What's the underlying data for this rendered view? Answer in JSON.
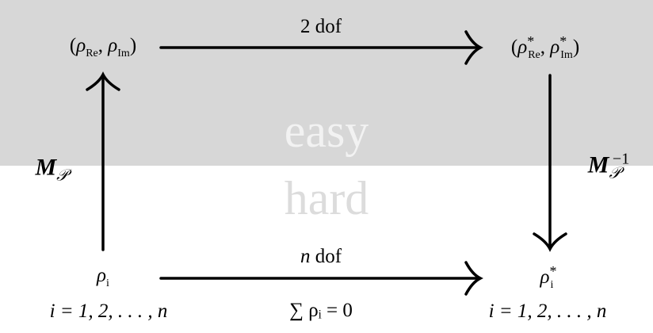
{
  "watermark": {
    "upper": "easy",
    "lower": "hard"
  },
  "nodes": {
    "top_left": {
      "rho": "ρ",
      "re": "Re",
      "im": "Im"
    },
    "top_right": {
      "rho": "ρ",
      "star": "*",
      "re": "Re",
      "im": "Im"
    },
    "bottom_left": {
      "rho": "ρ",
      "i": "i",
      "range": "i = 1, 2, . . . , n"
    },
    "bottom_right": {
      "rho": "ρ",
      "i": "i",
      "star": "*",
      "range": "i = 1, 2, . . . , n"
    }
  },
  "edges": {
    "top": {
      "label": "2 dof"
    },
    "bottom": {
      "label_var": "n",
      "label_rest": " dof",
      "constraint": "∑ ρᵢ = 0"
    },
    "left": {
      "base": "M",
      "sub": "𝒫"
    },
    "right": {
      "base": "M",
      "sub": "𝒫",
      "sup": "−1"
    }
  },
  "colors": {
    "band": "#d7d7d7",
    "arrow": "#000000",
    "easy": "#f2f2f2",
    "hard": "#dcdcdc"
  }
}
